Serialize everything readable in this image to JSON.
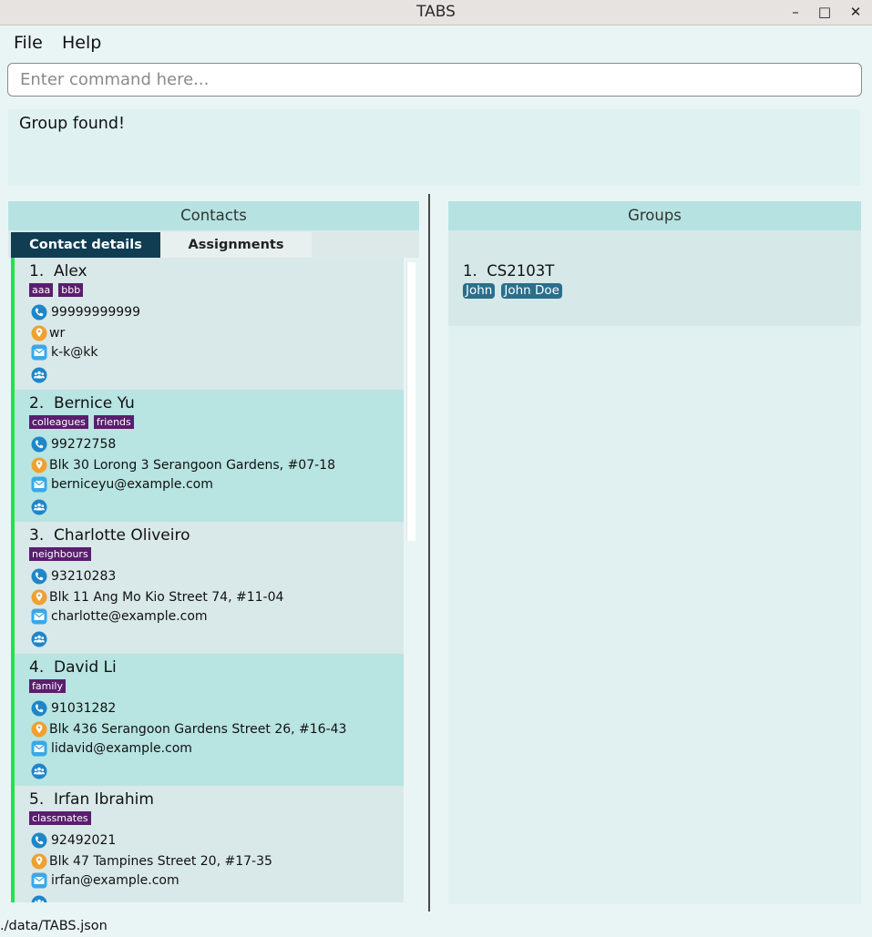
{
  "window": {
    "title": "TABS",
    "controls": {
      "minimize": "–",
      "maximize": "□",
      "close": "✕"
    }
  },
  "menu": {
    "file": "File",
    "help": "Help"
  },
  "command_box": {
    "placeholder": "Enter command here...",
    "value": ""
  },
  "result_display": {
    "text": "Group found!"
  },
  "contacts_panel": {
    "header": "Contacts",
    "tabs": {
      "details": "Contact details",
      "assignments": "Assignments"
    },
    "contacts": [
      {
        "index": "1.",
        "name": "Alex",
        "tags": [
          "aaa",
          "bbb"
        ],
        "phone": "99999999999",
        "address": "wr",
        "email": "k-k@kk"
      },
      {
        "index": "2.",
        "name": "Bernice Yu",
        "tags": [
          "colleagues",
          "friends"
        ],
        "phone": "99272758",
        "address": "Blk 30 Lorong 3 Serangoon Gardens, #07-18",
        "email": "berniceyu@example.com"
      },
      {
        "index": "3.",
        "name": "Charlotte Oliveiro",
        "tags": [
          "neighbours"
        ],
        "phone": "93210283",
        "address": "Blk 11 Ang Mo Kio Street 74, #11-04",
        "email": "charlotte@example.com"
      },
      {
        "index": "4.",
        "name": "David Li",
        "tags": [
          "family"
        ],
        "phone": "91031282",
        "address": "Blk 436 Serangoon Gardens Street 26, #16-43",
        "email": "lidavid@example.com"
      },
      {
        "index": "5.",
        "name": "Irfan Ibrahim",
        "tags": [
          "classmates"
        ],
        "phone": "92492021",
        "address": "Blk 47 Tampines Street 20, #17-35",
        "email": "irfan@example.com"
      }
    ],
    "icons": {
      "phone": "phone-icon",
      "address": "location-pin-icon",
      "email": "envelope-icon",
      "groups": "group-people-icon"
    }
  },
  "groups_panel": {
    "header": "Groups",
    "groups": [
      {
        "index": "1.",
        "name": "CS2103T",
        "members": [
          "John",
          "John Doe"
        ]
      }
    ]
  },
  "status_bar": {
    "path": "./data/TABS.json"
  },
  "colors": {
    "tag_bg": "#5a1e6e",
    "member_bg": "#2a6f8c",
    "header_bg": "#b6e3e1",
    "active_tab": "#113d52",
    "list_marker": "#26e04a"
  }
}
